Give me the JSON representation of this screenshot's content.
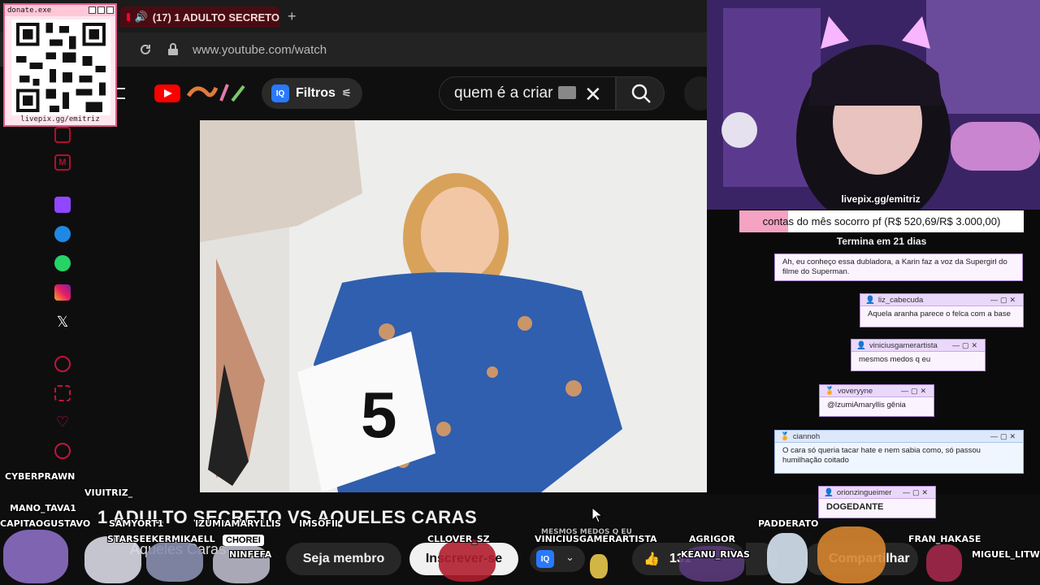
{
  "browser": {
    "tab_title": "(17) 1 ADULTO SECRETO",
    "url": "www.youtube.com/watch"
  },
  "youtube": {
    "filters_label": "Filtros",
    "search_value": "quem é a criar",
    "video_title": "1 ADULTO SECRETO VS AQUELES CARAS",
    "channel_name": "Aqueles Caras",
    "member_button": "Seja membro",
    "subscribe_button": "Inscrever-se",
    "like_count": "131",
    "share_button": "Compartilhar",
    "jersey_number": "5"
  },
  "donate": {
    "window_title": "donate.exe",
    "url": "livepix.gg/emitriz"
  },
  "stream": {
    "cam_caption": "livepix.gg/emitriz",
    "goal_text": "contas do mês socorro pf (R$ 520,69/R$ 3.000,00)",
    "goal_progress": 0.17,
    "goal_subtext": "Termina em 21 dias"
  },
  "chat": [
    {
      "user": "",
      "message": "Ah, eu conheço essa dubladora, a Karin faz a voz da Supergirl do filme do Superman."
    },
    {
      "user": "liz_cabecuda",
      "message": "Aquela aranha parece o felca com a base"
    },
    {
      "user": "viniciusgamerartista",
      "message": "mesmos medos q eu"
    },
    {
      "user": "voveryyne",
      "message": "@IzumiAmaryllis gênia"
    },
    {
      "user": "ciannoh",
      "message": "O cara só queria tacar hate e nem sabia como, só passou humilhação coitado"
    },
    {
      "user": "orionzingueimer",
      "message": "DOGEDANTE"
    }
  ],
  "chatters": [
    "CYBERPRAWN",
    "MANO_TAVA1",
    "VIUITRIZ_",
    "CAPITAOGUSTAVO",
    "SAMYORT1",
    "IZUMIAMARYLLIS",
    "IMSOFII",
    "STARSEEKERMIKAELL",
    "NINFEFA",
    "CLLOVER_SZ",
    "VINICIUSGAMERARTISTA",
    "AGRIGOR",
    "PADDERATO",
    "KEANU_RIVAS",
    "FRAN_HAKASE",
    "MIGUEL_LITW"
  ],
  "overlay_texts": {
    "chorei": "CHOREI",
    "mesmos_medos": "MESMOS MEDOS Q EU"
  },
  "colors": {
    "accent_pink": "#f4a3c3",
    "youtube_red": "#ff0000",
    "chat_border": "#b48bd8"
  }
}
